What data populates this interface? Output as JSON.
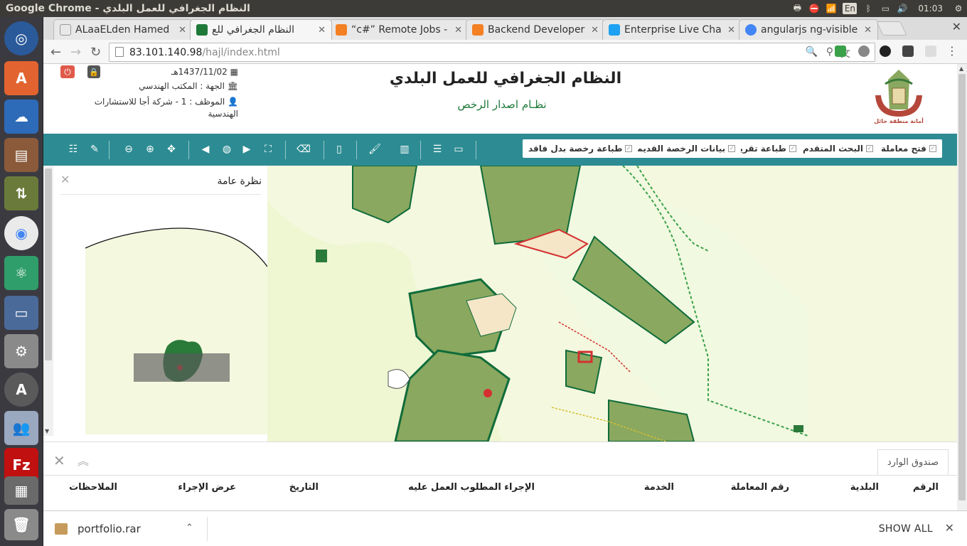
{
  "os": {
    "window_title": "Google Chrome - النظام الجغرافي للعمل البلدي",
    "keyboard_layout": "En",
    "clock": "01:03",
    "tray_icons": [
      "network-printer-icon",
      "do-not-disturb-icon",
      "wifi-icon",
      "keyboard-layout-icon",
      "bluetooth-icon",
      "battery-icon",
      "volume-icon",
      "clock",
      "power-gear-icon"
    ]
  },
  "launcher": {
    "items": [
      "ubuntu-dash-icon",
      "software-updater-icon",
      "cloud-icon",
      "file-manager-icon",
      "network-icon",
      "chrome-icon",
      "atom-icon",
      "remote-desktop-icon",
      "system-settings-icon",
      "software-center-icon",
      "users-icon",
      "filezilla-icon",
      "workspace-switcher-icon",
      "trash-icon"
    ]
  },
  "browser": {
    "tabs": [
      {
        "label": "ALaaELden Hamed",
        "fav_color": "#e8e8e8",
        "active": false
      },
      {
        "label": "النظام الجغرافي للع",
        "fav_color": "#1f7a3a",
        "active": true
      },
      {
        "label": "“c#” Remote Jobs -",
        "fav_color": "#f48024",
        "active": false
      },
      {
        "label": "Backend Developer",
        "fav_color": "#f48024",
        "active": false
      },
      {
        "label": "Enterprise Live Cha",
        "fav_color": "#1da1f2",
        "active": false
      },
      {
        "label": "angularjs ng-visible",
        "fav_color": "#4285f4",
        "active": false
      }
    ],
    "url_host": "83.101.140.98",
    "url_path": "/hajl/index.html"
  },
  "app": {
    "title": "النظام الجغرافي للعمل البلدي",
    "subtitle": "نظـام اصدار الرخص",
    "logo_caption": "أمانة منطقة حائل",
    "date": "1437/11/02هـ",
    "department": "الجهة : المكتب الهندسي",
    "employee": "الموظف : 1 - شركة أجا للاستشارات الهندسية"
  },
  "toolbar": {
    "buttons": [
      "فتح معاملة",
      "البحث المتقدم",
      "طباعة تقرير",
      "بيانات الرخصة القديمة",
      "طباعة رخصة بدل فاقد"
    ]
  },
  "overview": {
    "title": "نظرة عامة"
  },
  "bottom": {
    "tab_label": "صندوق الوارد",
    "columns": [
      "الرقم",
      "البلدية",
      "رقم المعاملة",
      "الخدمة",
      "الإجراء المطلوب العمل عليه",
      "التاريخ",
      "عرض الإجراء",
      "الملاحظات"
    ]
  },
  "downloads": {
    "file_name": "portfolio.rar",
    "show_all": "SHOW ALL"
  },
  "colors": {
    "toolbar_bg": "#2d8c93",
    "map_bg": "#f4f8de",
    "parcel_green": "#8aa85f",
    "parcel_border": "#0f6b3a",
    "accent_red": "#e02020"
  }
}
